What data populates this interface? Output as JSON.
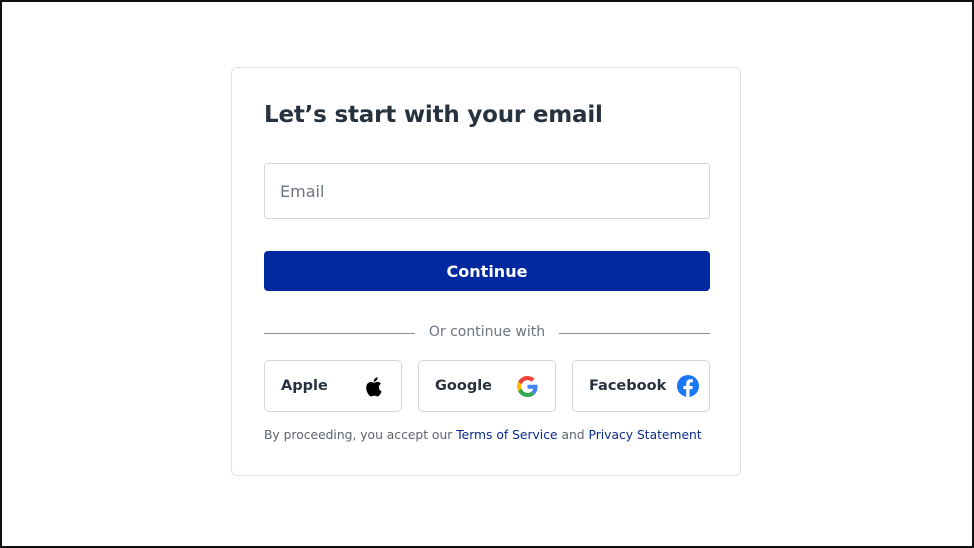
{
  "login": {
    "title": "Let’s start with your email",
    "email_placeholder": "Email",
    "email_value": "",
    "continue_label": "Continue",
    "divider_text": "Or continue with"
  },
  "social": {
    "apple_label": "Apple",
    "google_label": "Google",
    "facebook_label": "Facebook"
  },
  "terms": {
    "prefix": "By proceeding, you accept our ",
    "tos_link": "Terms of Service",
    "and": " and ",
    "privacy_link": "Privacy Statement"
  },
  "colors": {
    "primary": "#0029a0",
    "text": "#27323f",
    "link": "#0a2a8c",
    "facebook": "#1877f2"
  },
  "icons": {
    "apple": "apple-icon",
    "google": "google-icon",
    "facebook": "facebook-icon"
  }
}
